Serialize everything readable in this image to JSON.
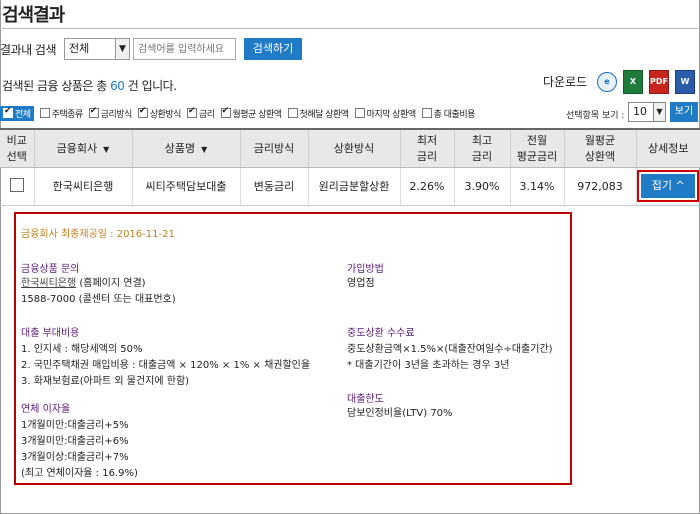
{
  "page_title": "검색결과",
  "search": {
    "label": "결과내 검색",
    "select_value": "전체",
    "placeholder": "검색어를 입력하세요",
    "button": "검색하기"
  },
  "count": {
    "prefix": "검색된 금융 상품은 총 ",
    "number": "60",
    "suffix": " 건 입니다."
  },
  "download": {
    "label": "다운로드",
    "icons": [
      "ie-icon",
      "excel-icon",
      "pdf-icon",
      "word-icon"
    ]
  },
  "filters": [
    {
      "label": "전체",
      "checked": true
    },
    {
      "label": "주택종류",
      "checked": false
    },
    {
      "label": "금리방식",
      "checked": true
    },
    {
      "label": "상환방식",
      "checked": true
    },
    {
      "label": "금리",
      "checked": true
    },
    {
      "label": "월평균 상환액",
      "checked": true
    },
    {
      "label": "첫해달 상환액",
      "checked": false
    },
    {
      "label": "마지막 상환액",
      "checked": false
    },
    {
      "label": "총 대출비용",
      "checked": false
    }
  ],
  "view": {
    "label": "선택항목 보기 :",
    "value": "10",
    "button": "보기"
  },
  "table": {
    "headers": {
      "compare_1": "비교",
      "compare_2": "선택",
      "company": "금융회사",
      "product": "상품명",
      "rate_type": "금리방식",
      "repay_type": "상환방식",
      "min_rate_1": "최저",
      "min_rate_2": "금리",
      "max_rate_1": "최고",
      "max_rate_2": "금리",
      "prev_avg_1": "전월",
      "prev_avg_2": "평균금리",
      "monthly_1": "월평균",
      "monthly_2": "상환액",
      "detail": "상세정보"
    },
    "row": {
      "company": "한국씨티은행",
      "product": "씨티주택담보대출",
      "rate_type": "변동금리",
      "repay_type": "원리금분할상환",
      "min_rate": "2.26%",
      "max_rate": "3.90%",
      "prev_avg": "3.14%",
      "monthly": "972,083",
      "collapse_button": "접기"
    }
  },
  "detail": {
    "disclosure": "금융회사 최종제공일 : 2016-11-21",
    "inquiry_title": "금융상품 문의",
    "inquiry_link": "한국씨티은행",
    "inquiry_link_suffix": " (홈페이지 연결)",
    "inquiry_phone": "1588-7000 (콜센터 또는 대표번호)",
    "join_title": "가입방법",
    "join_value": "영업점",
    "fees_title": "대출 부대비용",
    "fees_1": "1. 인지세 : 해당세액의 50%",
    "fees_2": "2. 국민주택채권 매입비용 : 대출금액 × 120% × 1% × 채권할인율",
    "fees_3": "3. 화재보험료(아파트 외 물건지에 한함)",
    "prepay_title": "중도상환 수수료",
    "prepay_1": "중도상환금액×1.5%×(대출잔여일수÷대출기간)",
    "prepay_2": "* 대출기간이 3년을 초과하는 경우 3년",
    "overdue_title": "연체 이자율",
    "overdue_1": "1개월미만:대출금리+5%",
    "overdue_2": "3개월미만:대출금리+6%",
    "overdue_3": "3개월이상:대출금리+7%",
    "overdue_4": "(최고 연체이자율 : 16.9%)",
    "limit_title": "대출한도",
    "limit_value": "담보인정비율(LTV) 70%"
  },
  "colors": {
    "accent": "#1f7bc6",
    "highlight_border": "#bb0000",
    "section_title": "#5b1a7a",
    "date": "#c07f1f"
  }
}
